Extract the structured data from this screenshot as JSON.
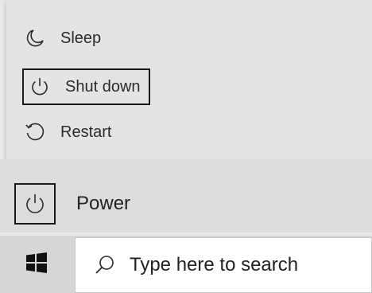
{
  "power_menu": {
    "items": [
      {
        "id": "sleep",
        "label": "Sleep",
        "icon": "moon-icon"
      },
      {
        "id": "shutdown",
        "label": "Shut down",
        "icon": "power-icon"
      },
      {
        "id": "restart",
        "label": "Restart",
        "icon": "restart-icon"
      }
    ]
  },
  "start_menu": {
    "power_label": "Power",
    "power_icon": "power-icon"
  },
  "taskbar": {
    "start_icon": "windows-logo-icon",
    "search_icon": "search-icon",
    "search_placeholder": "Type here to search"
  }
}
